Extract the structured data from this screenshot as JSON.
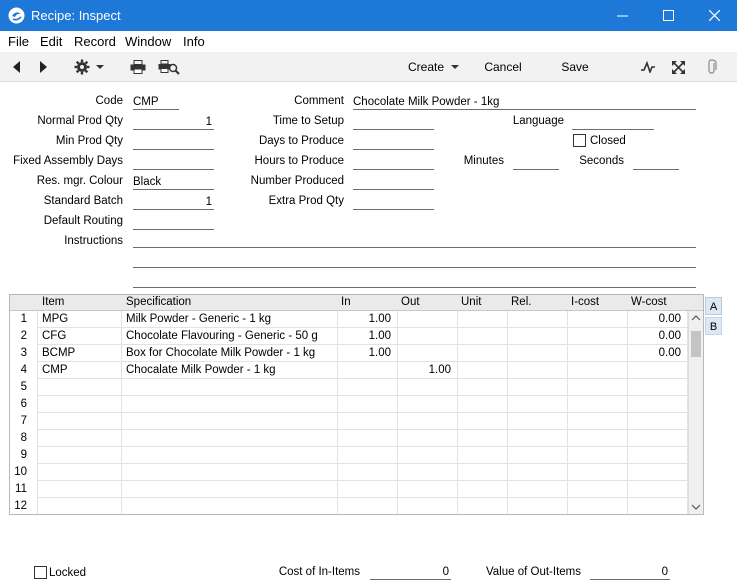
{
  "window": {
    "title": "Recipe: Inspect"
  },
  "menu": [
    "File",
    "Edit",
    "Record",
    "Window",
    "Info"
  ],
  "toolbar": {
    "create_label": "Create",
    "cancel_label": "Cancel",
    "save_label": "Save"
  },
  "header": {
    "code_label": "Code",
    "code_value": "CMP",
    "normal_prod_qty_label": "Normal Prod Qty",
    "normal_prod_qty_value": "1",
    "min_prod_qty_label": "Min Prod Qty",
    "min_prod_qty_value": "",
    "fixed_assembly_days_label": "Fixed Assembly Days",
    "fixed_assembly_days_value": "",
    "res_mgr_colour_label": "Res. mgr. Colour",
    "res_mgr_colour_value": "Black",
    "standard_batch_label": "Standard Batch",
    "standard_batch_value": "1",
    "default_routing_label": "Default Routing",
    "default_routing_value": "",
    "instructions_label": "Instructions",
    "comment_label": "Comment",
    "comment_value": "Chocolate Milk Powder - 1kg",
    "time_to_setup_label": "Time to Setup",
    "time_to_setup_value": "",
    "days_to_produce_label": "Days to Produce",
    "days_to_produce_value": "",
    "hours_to_produce_label": "Hours to Produce",
    "hours_to_produce_value": "",
    "number_produced_label": "Number Produced",
    "number_produced_value": "",
    "extra_prod_qty_label": "Extra Prod Qty",
    "extra_prod_qty_value": "",
    "language_label": "Language",
    "language_value": "",
    "closed_label": "Closed",
    "minutes_label": "Minutes",
    "minutes_value": "",
    "seconds_label": "Seconds",
    "seconds_value": ""
  },
  "grid": {
    "columns": [
      "Item",
      "Specification",
      "In",
      "Out",
      "Unit",
      "Rel.",
      "I-cost",
      "W-cost"
    ],
    "rows": [
      {
        "n": "1",
        "item": "MPG",
        "spec": "Milk Powder - Generic - 1 kg",
        "in": "1.00",
        "out": "",
        "unit": "",
        "rel": "",
        "icost": "",
        "wcost": "0.00"
      },
      {
        "n": "2",
        "item": "CFG",
        "spec": "Chocolate Flavouring - Generic - 50 g",
        "in": "1.00",
        "out": "",
        "unit": "",
        "rel": "",
        "icost": "",
        "wcost": "0.00"
      },
      {
        "n": "3",
        "item": "BCMP",
        "spec": "Box for Chocolate Milk Powder - 1 kg",
        "in": "1.00",
        "out": "",
        "unit": "",
        "rel": "",
        "icost": "",
        "wcost": "0.00"
      },
      {
        "n": "4",
        "item": "CMP",
        "spec": "Chocalate Milk Powder - 1 kg",
        "in": "",
        "out": "1.00",
        "unit": "",
        "rel": "",
        "icost": "",
        "wcost": ""
      },
      {
        "n": "5",
        "item": "",
        "spec": "",
        "in": "",
        "out": "",
        "unit": "",
        "rel": "",
        "icost": "",
        "wcost": ""
      },
      {
        "n": "6",
        "item": "",
        "spec": "",
        "in": "",
        "out": "",
        "unit": "",
        "rel": "",
        "icost": "",
        "wcost": ""
      },
      {
        "n": "7",
        "item": "",
        "spec": "",
        "in": "",
        "out": "",
        "unit": "",
        "rel": "",
        "icost": "",
        "wcost": ""
      },
      {
        "n": "8",
        "item": "",
        "spec": "",
        "in": "",
        "out": "",
        "unit": "",
        "rel": "",
        "icost": "",
        "wcost": ""
      },
      {
        "n": "9",
        "item": "",
        "spec": "",
        "in": "",
        "out": "",
        "unit": "",
        "rel": "",
        "icost": "",
        "wcost": ""
      },
      {
        "n": "10",
        "item": "",
        "spec": "",
        "in": "",
        "out": "",
        "unit": "",
        "rel": "",
        "icost": "",
        "wcost": ""
      },
      {
        "n": "11",
        "item": "",
        "spec": "",
        "in": "",
        "out": "",
        "unit": "",
        "rel": "",
        "icost": "",
        "wcost": ""
      },
      {
        "n": "12",
        "item": "",
        "spec": "",
        "in": "",
        "out": "",
        "unit": "",
        "rel": "",
        "icost": "",
        "wcost": ""
      }
    ],
    "tabs": [
      "A",
      "B"
    ]
  },
  "footer": {
    "locked_label": "Locked",
    "cost_in_items_label": "Cost of In-Items",
    "cost_in_items_value": "0",
    "value_out_items_label": "Value of Out-Items",
    "value_out_items_value": "0"
  },
  "colors": {
    "titlebar": "#1e78d8",
    "toolbar": "#f2f2f2",
    "active_tab": "#dde8f6"
  }
}
